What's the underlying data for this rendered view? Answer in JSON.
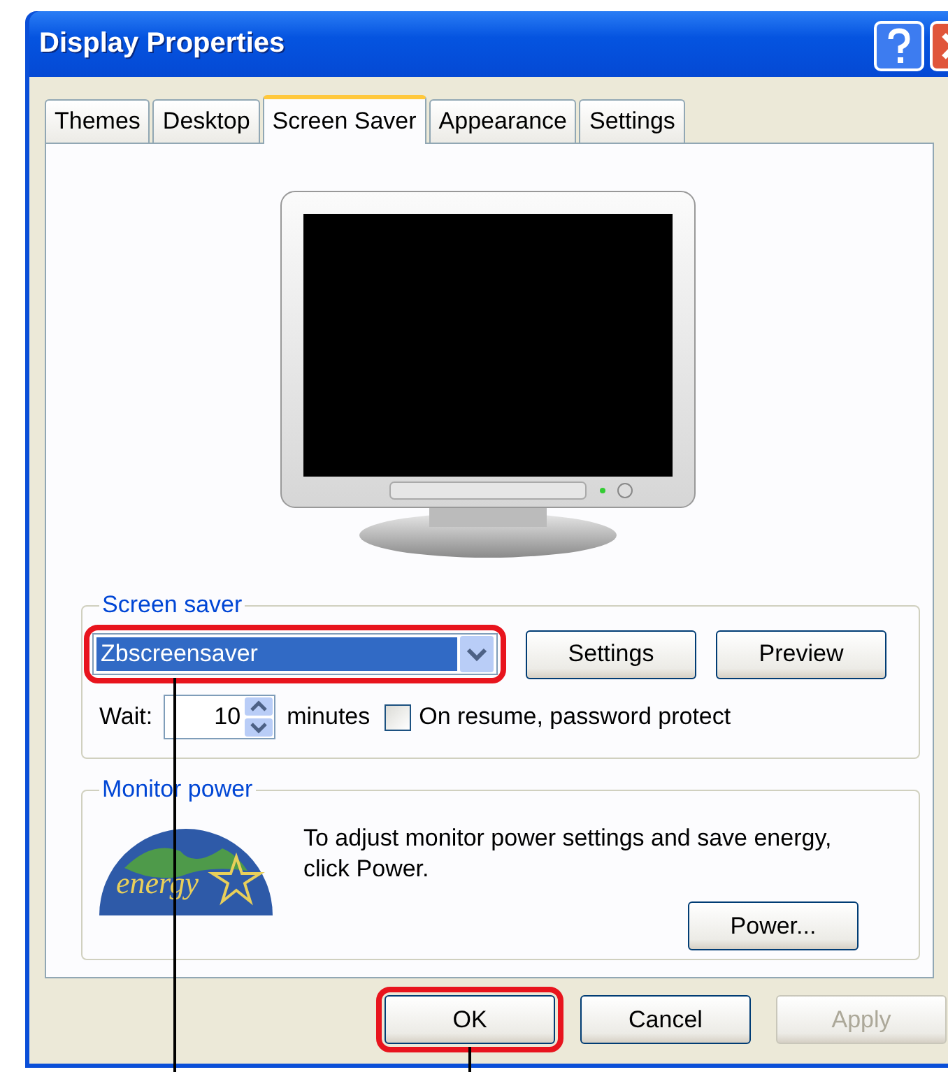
{
  "window": {
    "title": "Display Properties"
  },
  "tabs": [
    {
      "label": "Themes",
      "selected": false
    },
    {
      "label": "Desktop",
      "selected": false
    },
    {
      "label": "Screen Saver",
      "selected": true
    },
    {
      "label": "Appearance",
      "selected": false
    },
    {
      "label": "Settings",
      "selected": false
    }
  ],
  "screen_saver": {
    "group_label": "Screen saver",
    "selected_saver": "Zbscreensaver",
    "highlighted": true,
    "buttons": [
      "Settings",
      "Preview"
    ],
    "wait_label": "Wait:",
    "wait_value": "10",
    "wait_unit": "minutes",
    "password_protect": {
      "label": "On resume, password protect",
      "checked": false
    }
  },
  "monitor_power": {
    "group_label": "Monitor power",
    "logo_text": "energy",
    "description": "To adjust monitor power settings and save energy, click Power.",
    "button": "Power..."
  },
  "buttons": [
    {
      "label": "OK",
      "highlighted": true,
      "disabled": false
    },
    {
      "label": "Cancel",
      "highlighted": false,
      "disabled": false
    },
    {
      "label": "Apply",
      "highlighted": false,
      "disabled": true
    }
  ]
}
